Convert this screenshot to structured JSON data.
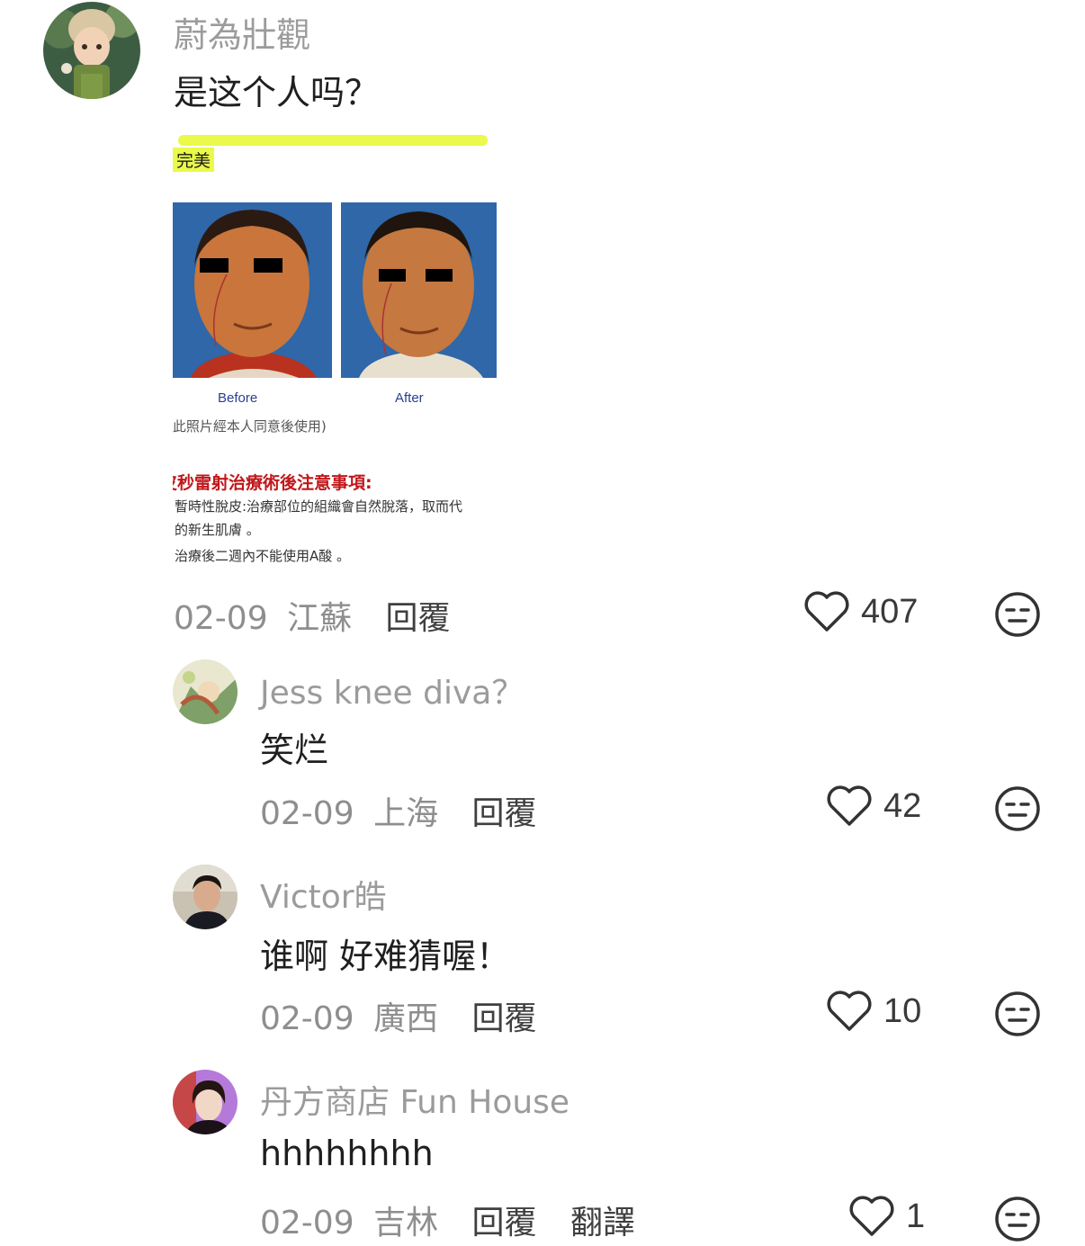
{
  "comments": [
    {
      "username": "蔚為壯觀",
      "text": "是这个人吗？",
      "date": "02-09",
      "location": "江蘇",
      "reply_label": "回覆",
      "likes": "407",
      "image": {
        "top_caption": "完美",
        "before_label": "Before",
        "after_label": "After",
        "consent_note": "(此照片經本人同意後使用)",
        "heading": "皮秒雷射治療術後注意事項:",
        "line1": "暫時性脫皮:治療部位的組織會自然脫落，取而代",
        "line2": "的新生肌膚 。",
        "line3": "治療後二週內不能使用A酸 。"
      }
    },
    {
      "username": "Jess knee diva？",
      "text": "笑烂",
      "date": "02-09",
      "location": "上海",
      "reply_label": "回覆",
      "likes": "42"
    },
    {
      "username": "Victor皓",
      "text": "谁啊 好难猜喔！",
      "date": "02-09",
      "location": "廣西",
      "reply_label": "回覆",
      "likes": "10"
    },
    {
      "username": "丹方商店 Fun House",
      "text": "hhhhhhhh",
      "date": "02-09",
      "location": "吉林",
      "reply_label": "回覆",
      "translate_label": "翻譯",
      "likes": "1"
    }
  ],
  "icons": {
    "like": "heart-outline-icon",
    "dislike": "unamused-face-icon"
  },
  "colors": {
    "username": "#9b9b9b",
    "meta": "#8e8e8e",
    "text": "#1f1f1f",
    "heading_red": "#c0171b",
    "highlight": "#eaf94a",
    "photo_bg": "#2f67a8"
  }
}
